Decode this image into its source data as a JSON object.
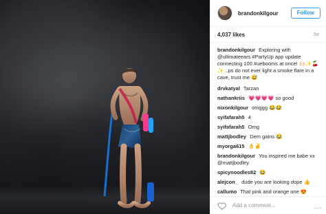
{
  "post": {
    "username": "brandonkilgour",
    "follow_label": "Follow",
    "likes": "4,037 likes",
    "time": "3w",
    "caption": "Exploring with @ultimateears #PartyUp app update connecting 100 #uebooms at once! 🙌🏻✨🍒✨ ..ps do not ever light a smoke flare in a cave, trust me 😅"
  },
  "comments": [
    {
      "user": "drvkatyal",
      "text": "Tarzan"
    },
    {
      "user": "nathankriis",
      "text": "💗💗💗💗 so good"
    },
    {
      "user": "nixonkilgour",
      "text": "omggg 😂😂"
    },
    {
      "user": "syifafarah5",
      "text": "4"
    },
    {
      "user": "syifafarah5",
      "text": "Omg"
    },
    {
      "user": "mattjbodley",
      "text": "Dem gains 😂"
    },
    {
      "user": "myorga615",
      "text": "👌✌️"
    },
    {
      "user": "brandonkilgour",
      "text": "You inspired me babe xx @mattjbodley"
    },
    {
      "user": "spicynoodles82",
      "text": "😂"
    },
    {
      "user": "alejcon_",
      "text": "dude you are looking dope 👍"
    },
    {
      "user": "callumo",
      "text": "That pink and orange one 😍"
    }
  ],
  "footer": {
    "add_comment_placeholder": "Add a comment...",
    "more_label": "…"
  },
  "icons": {
    "heart": "heart-icon",
    "more": "more-icon"
  },
  "colors": {
    "accent": "#3897f0",
    "muted": "#999999",
    "divider": "#efefef"
  }
}
